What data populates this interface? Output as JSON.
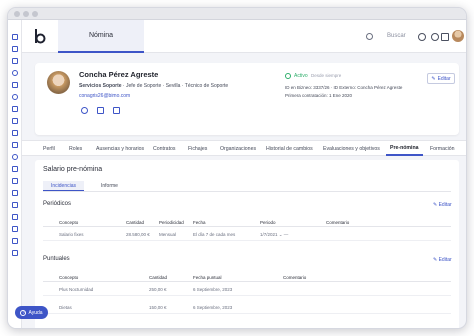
{
  "topbar": {
    "section": "Nómina",
    "search_placeholder": "Buscar"
  },
  "profile": {
    "name": "Concha Pérez Agreste",
    "department": "Servicios Soporte",
    "roles": "· Jefe de Soporte · Sevilla · Técnico de Soporte",
    "email": "conagris26@bimo.com",
    "status": "Activo",
    "status_sub": "Desde siempre",
    "id_line": "ID en Bizneo: 3337/26 · ID Externo: Concha Pérez Agreste",
    "contract_line": "Primera contratación: 1 Ene 2020",
    "edit_label": "Editar"
  },
  "tabs": [
    "Perfil",
    "Roles",
    "Ausencias y horarios",
    "Contratos",
    "Fichajes",
    "Organizaciones",
    "Historial de cambios",
    "Evaluaciones y objetivos",
    "Pre-nómina",
    "Formación"
  ],
  "active_tab": "Pre-nómina",
  "panel": {
    "title": "Salario pre-nómina",
    "subtabs": [
      "Incidencias",
      "Informe"
    ],
    "periodicos": {
      "title": "Periódicos",
      "edit_label": "Editar",
      "columns": [
        "Concepto",
        "Cantidad",
        "Periodicidad",
        "Fecha",
        "Periodo",
        "Comentario"
      ],
      "rows": [
        {
          "concepto": "Salario fixes",
          "cantidad": "28.580,00 €",
          "periodicidad": "Mensual",
          "fecha": "El día 7 de cada mes",
          "periodo": "1/7/2021 ⌄ —"
        }
      ]
    },
    "puntuales": {
      "title": "Puntuales",
      "edit_label": "Editar",
      "columns": [
        "Concepto",
        "Cantidad",
        "Fecha puntual",
        "Comentario"
      ],
      "rows": [
        {
          "concepto": "Plus Nocturnidad",
          "cantidad": "250,00 €",
          "fecha": "6 Septiembre, 2023"
        },
        {
          "concepto": "Dietas",
          "cantidad": "150,00 €",
          "fecha": "6 Septiembre, 2023"
        }
      ]
    }
  },
  "help_label": "Ayuda",
  "colors": {
    "accent": "#3e55c7",
    "status_green": "#2dae6a"
  }
}
